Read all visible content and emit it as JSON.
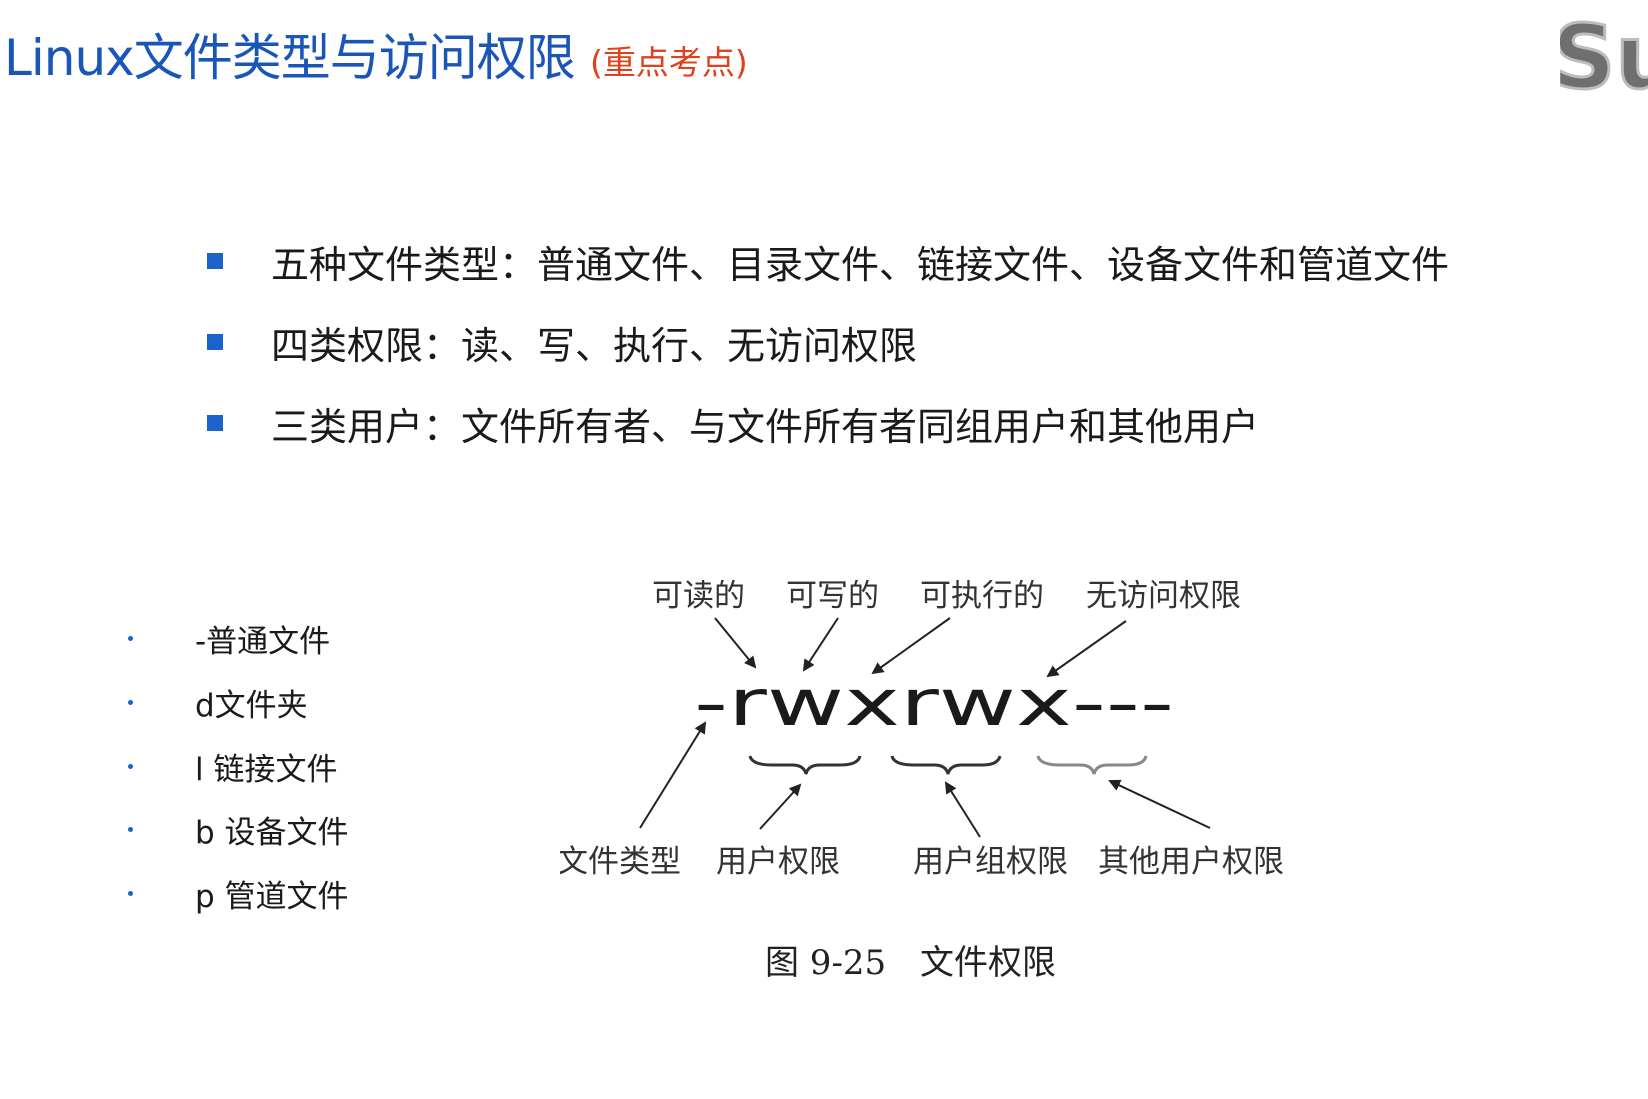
{
  "slide": {
    "title": "Linux文件类型与访问权限",
    "title_note": "(重点考点)",
    "logo_text": "Su"
  },
  "bullets": [
    {
      "text": "五种文件类型：普通文件、目录文件、链接文件、设备文件和管道文件"
    },
    {
      "text": "四类权限：读、写、执行、无访问权限"
    },
    {
      "text": "三类用户：文件所有者、与文件所有者同组用户和其他用户"
    }
  ],
  "file_types": [
    {
      "text": "-普通文件"
    },
    {
      "text": "d文件夹"
    },
    {
      "text": "l 链接文件"
    },
    {
      "text": "b 设备文件"
    },
    {
      "text": "p 管道文件"
    }
  ],
  "diagram": {
    "top_labels": [
      "可读的",
      "可写的",
      "可执行的",
      "无访问权限"
    ],
    "permission_string": "-rwxrwx---",
    "bottom_labels": [
      "文件类型",
      "用户权限",
      "用户组权限",
      "其他用户权限"
    ],
    "caption_number": "图 9-25",
    "caption_text": "文件权限"
  },
  "colors": {
    "title": "#1a56b8",
    "title_note": "#e0401a",
    "bullet": "#1a63c9"
  }
}
